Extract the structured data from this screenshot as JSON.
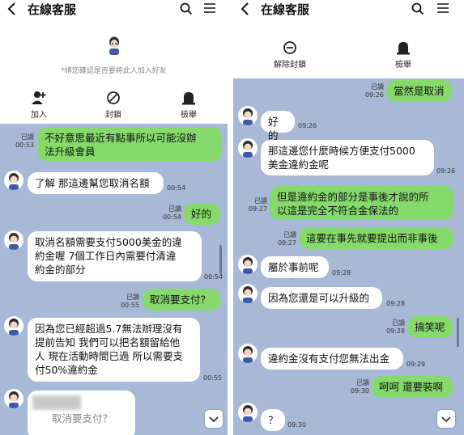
{
  "left": {
    "title": "在線客服",
    "profile_hint": "*請您確認是否要將此人加入好友",
    "actions": [
      {
        "label": "加入",
        "icon": "add-friend-icon"
      },
      {
        "label": "封鎖",
        "icon": "block-icon"
      },
      {
        "label": "檢舉",
        "icon": "report-icon"
      }
    ],
    "messages": [
      {
        "dir": "out",
        "lines": [
          "不好意思最近有點事所以可能沒辦",
          "法升級會員"
        ],
        "read": "已讀",
        "time": "00:53"
      },
      {
        "dir": "in",
        "lines": [
          "了解 那這邊幫您取消名額"
        ],
        "time": "00:54"
      },
      {
        "dir": "out",
        "lines": [
          "好的"
        ],
        "read": "已讀",
        "time": "00:54"
      },
      {
        "dir": "in",
        "lines": [
          "取消名額需要支付5000美金的違",
          "約金喔 7個工作日內需要付清違",
          "約金的部分"
        ],
        "time": "00:54"
      },
      {
        "dir": "out",
        "lines": [
          "取消要支付？"
        ],
        "read": "已讀",
        "time": "00:55"
      },
      {
        "dir": "in",
        "lines": [
          "因為您已經超過5.7無法辦理沒有",
          "提前告知 我們可以把名額留給他",
          "人 現在活動時間已過 所以需要支",
          "付50%違約金"
        ],
        "time": "00:55"
      },
      {
        "dir": "in",
        "lines": [
          "取消要支付？"
        ],
        "time": ""
      }
    ]
  },
  "right": {
    "title": "在線客服",
    "actions": [
      {
        "label": "解除封鎖",
        "icon": "unblock-icon"
      },
      {
        "label": "檢舉",
        "icon": "report-icon"
      }
    ],
    "messages": [
      {
        "dir": "out",
        "lines": [
          "當然是取消"
        ],
        "read": "已讀",
        "time": "09:26"
      },
      {
        "dir": "in",
        "lines": [
          "好的"
        ],
        "time": "09:26"
      },
      {
        "dir": "in",
        "lines": [
          "那這邊您什麼時候方便支付5000",
          "美金違約金呢"
        ],
        "time": "09:26"
      },
      {
        "dir": "out",
        "lines": [
          "但是違約金的部分是事後才說的所",
          "以這是完全不符合金保法的"
        ],
        "read": "已讀",
        "time": "09:27"
      },
      {
        "dir": "out",
        "lines": [
          "這要在事先就要提出而非事後"
        ],
        "read": "已讀",
        "time": "09:27"
      },
      {
        "dir": "in",
        "lines": [
          "屬於事前呢"
        ],
        "time": "09:28"
      },
      {
        "dir": "in",
        "lines": [
          "因為您還是可以升級的"
        ],
        "time": "09:28"
      },
      {
        "dir": "out",
        "lines": [
          "搞笑呢"
        ],
        "read": "已讀",
        "time": "09:28"
      },
      {
        "dir": "in",
        "lines": [
          "違約金沒有支付您無法出金"
        ],
        "time": "09:29"
      },
      {
        "dir": "out",
        "lines": [
          "呵呵 還要裝啊"
        ],
        "read": "已讀",
        "time": "09:30"
      },
      {
        "dir": "in",
        "lines": [
          "？"
        ],
        "time": "09:30"
      }
    ]
  },
  "colors": {
    "chat_bg": "#a7b9d7",
    "out_bubble": "#86d96b",
    "in_bubble": "#ffffff"
  }
}
